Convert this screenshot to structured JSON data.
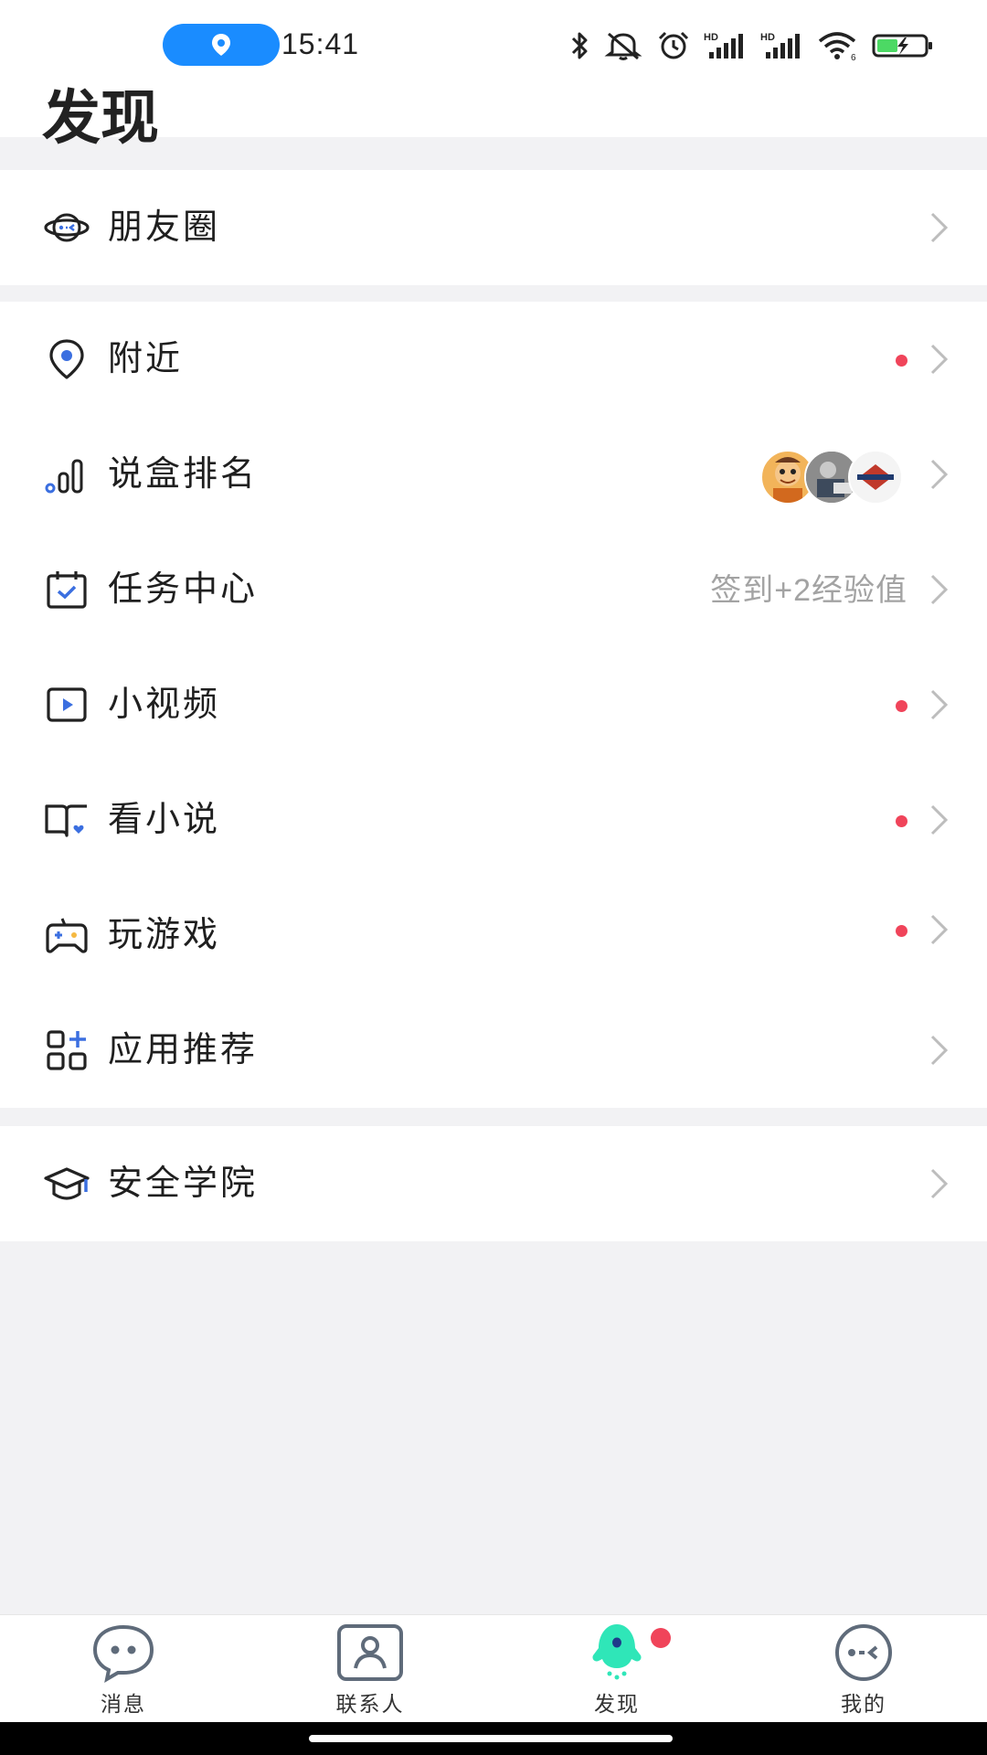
{
  "status_bar": {
    "time": "15:41",
    "icons": [
      "location-pill-icon",
      "bluetooth-icon",
      "mute-icon",
      "alarm-icon",
      "hd-signal-icon",
      "hd-signal-icon",
      "wifi-icon",
      "battery-charging-icon"
    ]
  },
  "header": {
    "title": "发现"
  },
  "sections": [
    {
      "items": [
        {
          "label": "朋友圈",
          "icon": "planet-face-icon"
        }
      ]
    },
    {
      "items": [
        {
          "label": "附近",
          "icon": "location-pin-icon",
          "dot": true
        },
        {
          "label": "说盒排名",
          "icon": "ranking-bars-icon",
          "avatars": [
            "avatar-cartoon",
            "avatar-photo",
            "avatar-badge"
          ]
        },
        {
          "label": "任务中心",
          "icon": "calendar-check-icon",
          "hint": "签到+2经验值"
        },
        {
          "label": "小视频",
          "icon": "video-play-icon",
          "dot": true
        },
        {
          "label": "看小说",
          "icon": "open-book-icon",
          "dot": true
        },
        {
          "label": "玩游戏",
          "icon": "gamepad-icon",
          "dot": true
        },
        {
          "label": "应用推荐",
          "icon": "apps-grid-icon"
        }
      ]
    },
    {
      "items": [
        {
          "label": "安全学院",
          "icon": "graduation-cap-icon"
        }
      ]
    }
  ],
  "bottom_nav": [
    {
      "label": "消息",
      "icon": "chat-bubble-icon"
    },
    {
      "label": "联系人",
      "icon": "contact-person-icon"
    },
    {
      "label": "发现",
      "icon": "discover-rocket-icon",
      "active": true,
      "badge": true
    },
    {
      "label": "我的",
      "icon": "profile-face-icon"
    }
  ],
  "colors": {
    "accent": "#1a8cff",
    "badge": "#f0445a",
    "icon_blue": "#3b6fe0",
    "discover_green": "#2fe6b8",
    "hint_gray": "#a3a3a3",
    "background": "#f2f2f4"
  }
}
